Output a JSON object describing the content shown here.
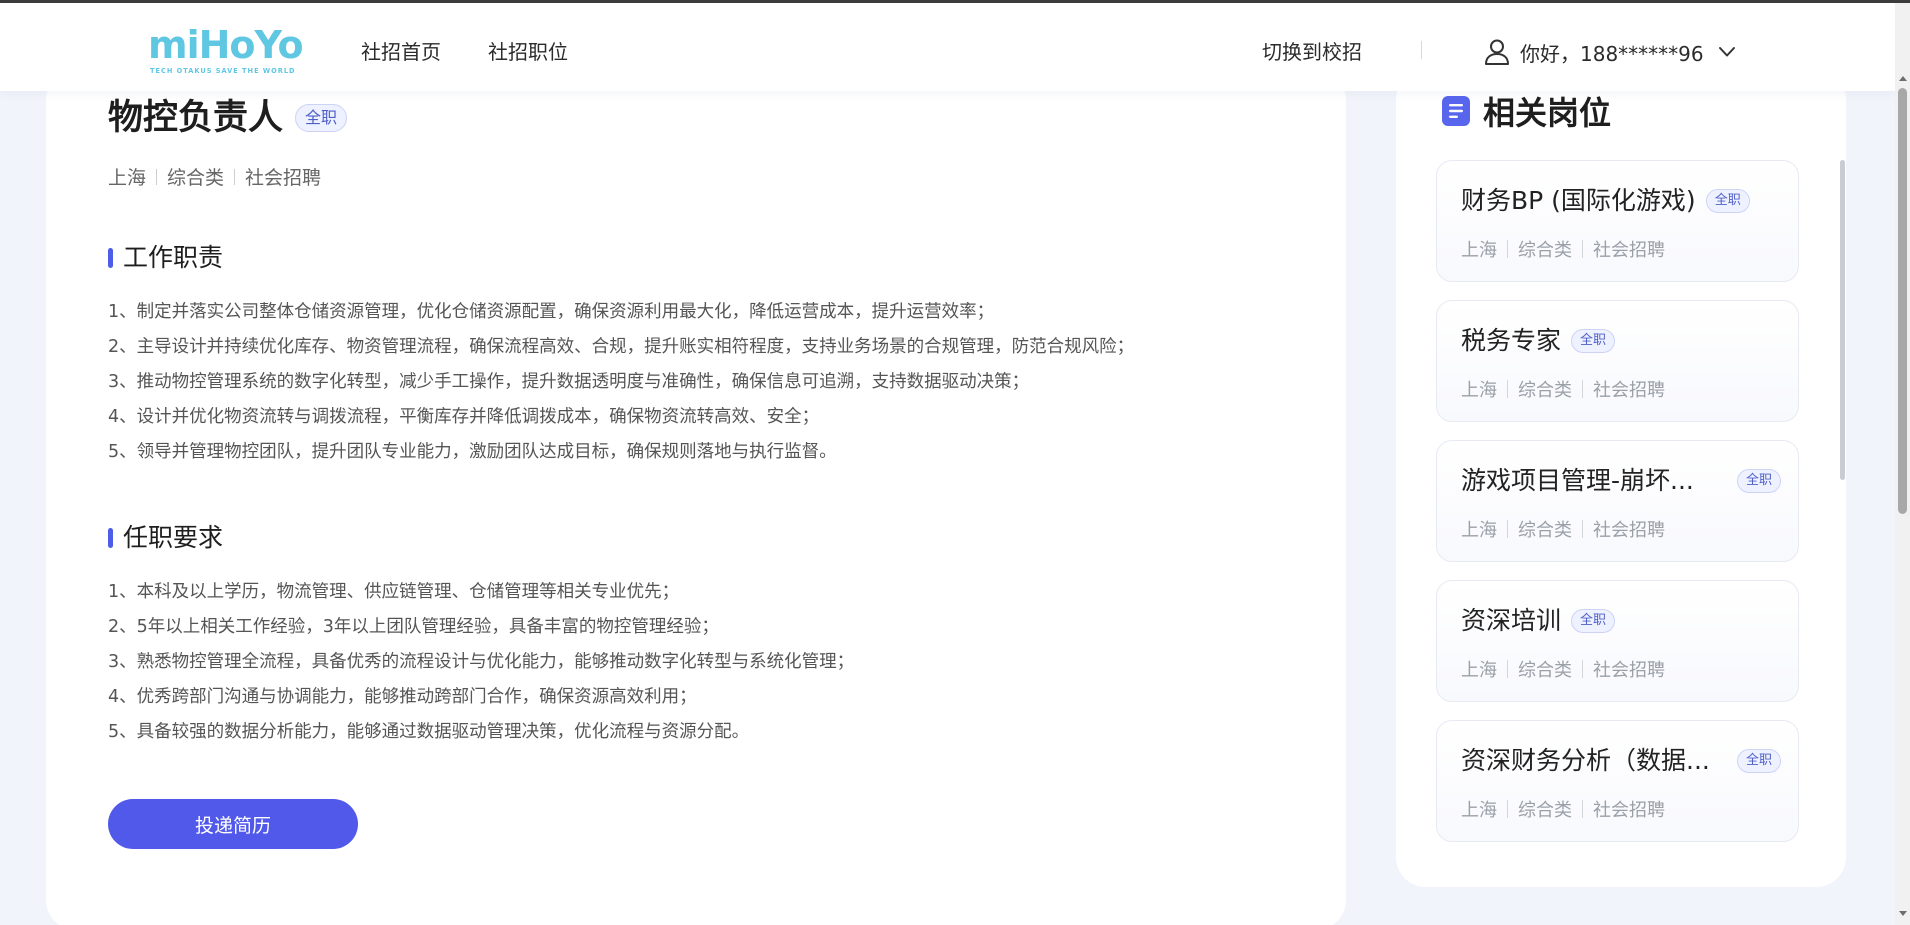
{
  "header": {
    "logo_text": "miHoYo",
    "logo_tagline": "TECH OTAKUS SAVE THE WORLD",
    "nav": [
      {
        "label": "社招首页"
      },
      {
        "label": "社招职位"
      }
    ],
    "switch_campus_label": "切换到校招",
    "greeting": "你好，188******96",
    "icons": {
      "user": "user-icon",
      "dropdown": "chevron-down-icon"
    }
  },
  "job": {
    "title": "物控负责人",
    "type_tag": "全职",
    "meta": [
      "上海",
      "综合类",
      "社会招聘"
    ],
    "duties_title": "工作职责",
    "duties": [
      "1、制定并落实公司整体仓储资源管理，优化仓储资源配置，确保资源利用最大化，降低运营成本，提升运营效率；",
      "2、主导设计并持续优化库存、物资管理流程，确保流程高效、合规，提升账实相符程度，支持业务场景的合规管理，防范合规风险；",
      "3、推动物控管理系统的数字化转型，减少手工操作，提升数据透明度与准确性，确保信息可追溯，支持数据驱动决策；",
      "4、设计并优化物资流转与调拨流程，平衡库存并降低调拨成本，确保物资流转高效、安全；",
      "5、领导并管理物控团队，提升团队专业能力，激励团队达成目标，确保规则落地与执行监督。"
    ],
    "requirements_title": "任职要求",
    "requirements": [
      "1、本科及以上学历，物流管理、供应链管理、仓储管理等相关专业优先；",
      "2、5年以上相关工作经验，3年以上团队管理经验，具备丰富的物控管理经验；",
      "3、熟悉物控管理全流程，具备优秀的流程设计与优化能力，能够推动数字化转型与系统化管理；",
      "4、优秀跨部门沟通与协调能力，能够推动跨部门合作，确保资源高效利用；",
      "5、具备较强的数据分析能力，能够通过数据驱动管理决策，优化流程与资源分配。"
    ],
    "apply_label": "投递简历"
  },
  "related": {
    "title": "相关岗位",
    "icon": "document-icon",
    "jobs": [
      {
        "title": "财务BP (国际化游戏)",
        "tag": "全职",
        "city": "上海",
        "category": "综合类",
        "recruit": "社会招聘"
      },
      {
        "title": "税务专家",
        "tag": "全职",
        "city": "上海",
        "category": "综合类",
        "recruit": "社会招聘"
      },
      {
        "title": "游戏项目管理-崩坏...",
        "tag": "全职",
        "city": "上海",
        "category": "综合类",
        "recruit": "社会招聘"
      },
      {
        "title": "资深培训",
        "tag": "全职",
        "city": "上海",
        "category": "综合类",
        "recruit": "社会招聘"
      },
      {
        "title": "资深财务分析（数据...",
        "tag": "全职",
        "city": "上海",
        "category": "综合类",
        "recruit": "社会招聘"
      }
    ]
  },
  "colors": {
    "accent": "#5059ea",
    "section_bar": "#4d5de8",
    "tag_text": "#4f5fc8",
    "logo": "#5fc7e2",
    "background": "#f2f4fb"
  }
}
